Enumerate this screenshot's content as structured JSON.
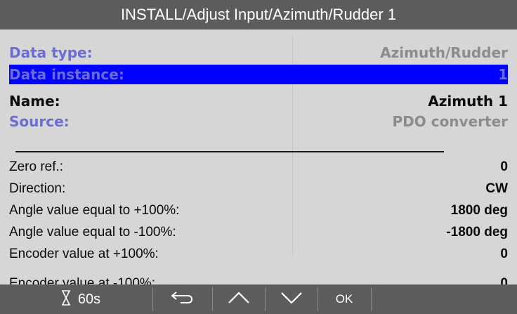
{
  "title": "INSTALL/Adjust Input/Azimuth/Rudder 1",
  "header_rows": [
    {
      "label": "Data type:",
      "value": "Azimuth/Rudder"
    },
    {
      "label": "Data instance:",
      "value": "1"
    },
    {
      "label": "Name:",
      "value": "Azimuth 1"
    },
    {
      "label": "Source:",
      "value": "PDO converter"
    }
  ],
  "parameters": [
    {
      "label": "Zero ref.:",
      "value": "0"
    },
    {
      "label": "Direction:",
      "value": "CW"
    },
    {
      "label": "Angle value equal to +100%:",
      "value": "1800 deg"
    },
    {
      "label": "Angle value equal to -100%:",
      "value": "-1800 deg"
    },
    {
      "label": "Encoder value at +100%:",
      "value": "0"
    },
    {
      "label": "Encoder value at -100%:",
      "value": "0"
    }
  ],
  "bottom_bar": {
    "timer_icon": "hourglass-icon",
    "timer": "60s",
    "back_icon": "back-arrow-icon",
    "up_icon": "chevron-up-icon",
    "down_icon": "chevron-down-icon",
    "ok": "OK"
  },
  "colors": {
    "bar": "#5c5c5c",
    "background": "#d6d6d6",
    "selection": "#0000ff",
    "info_label": "#6b6bd9",
    "info_value": "#8c8c8c"
  }
}
